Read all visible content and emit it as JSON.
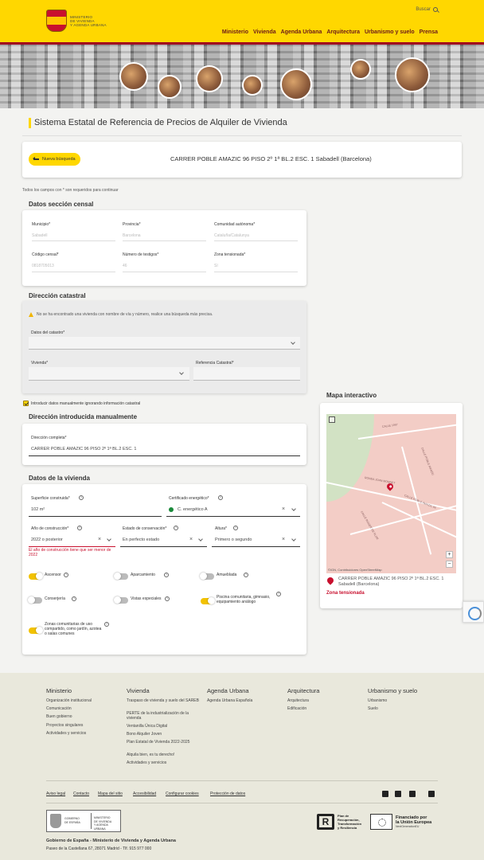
{
  "header": {
    "logo_lines": [
      "MINISTERIO",
      "DE VIVIENDA",
      "Y AGENDA URBANA"
    ],
    "search_label": "Buscar",
    "nav": [
      "Ministerio",
      "Vivienda",
      "Agenda Urbana",
      "Arquitectura",
      "Urbanismo y suelo",
      "Prensa"
    ]
  },
  "page": {
    "title": "Sistema Estatal de Referencia de Precios de Alquiler de Vivienda",
    "back_button": "Nueva búsqueda",
    "address": "CARRER POBLE AMAZIC 96 PISO 2º 1ª BL.2 ESC. 1 Sabadell (Barcelona)",
    "required_note": "Todos los campos con * son requeridos para continuar"
  },
  "censal": {
    "title": "Datos sección censal",
    "fields": [
      {
        "label": "Municipio*",
        "value": "Sabadell"
      },
      {
        "label": "Provincia*",
        "value": "Barcelona"
      },
      {
        "label": "Comunidad autónoma*",
        "value": "Cataluña/Catalunya"
      },
      {
        "label": "Código censal*",
        "value": "0818705013"
      },
      {
        "label": "Número de testigos*",
        "value": "46"
      },
      {
        "label": "Zona tensionada*",
        "value": "Sí"
      }
    ]
  },
  "catastral": {
    "title": "Dirección catastral",
    "warning": "No se ha encontrado una vivienda con nombre de vía y número, realice una búsqueda más precisa.",
    "datos_label": "Datos del catastro*",
    "vivienda_label": "Vivienda*",
    "referencia_label": "Referencia Catastral*",
    "manual_checkbox": "Introducir datos manualmente ignorando información catastral"
  },
  "manual": {
    "title": "Dirección introducida manualmente",
    "label": "Dirección completa*",
    "value": "CARRER POBLE AMAZIC 96 PISO 2º 1ª BL.2 ESC. 1"
  },
  "vivienda": {
    "title": "Datos de la vivienda",
    "superficie_label": "Superficie construida*",
    "superficie_value": "102 m²",
    "certificado_label": "Certificado energético*",
    "certificado_value": "C. energético A",
    "anio_label": "Año de construcción*",
    "anio_value": "2022 o posterior",
    "anio_error": "El año de construcción tiene que ser menor de 2022",
    "estado_label": "Estado de conservación*",
    "estado_value": "En perfecto estado",
    "altura_label": "Altura*",
    "altura_value": "Primero o segundo",
    "toggles": [
      {
        "label": "Ascensor",
        "on": true
      },
      {
        "label": "Aparcamiento",
        "on": false
      },
      {
        "label": "Amueblada",
        "on": false
      },
      {
        "label": "Conserjería",
        "on": false
      },
      {
        "label": "Vistas especiales",
        "on": false
      },
      {
        "label": "Piscina comunitaria, gimnasio, equipamiento análogo",
        "on": true
      },
      {
        "label": "Zonas comunitarias de uso compartido, como jardín, azotea o salas comunes",
        "on": true
      }
    ]
  },
  "map": {
    "title": "Mapa interactivo",
    "streets": [
      "CALLE 1967",
      "CALLE POBLE AMAZIC 96",
      "RONDA JOAN MONNET",
      "CALLE POBLE AMAZIC",
      "CALLE ROGER DE FLOR"
    ],
    "attribution": "©IGN, Contribuidores OpenStreetMap",
    "address_line1": "CARRER POBLE AMAZIC 96 PISO 2º 1ª BL.2 ESC. 1",
    "address_line2": "Sabadell (Barcelona)",
    "zona": "Zona tensionada",
    "zoom_in": "+",
    "zoom_out": "−"
  },
  "footer": {
    "columns": [
      {
        "title": "Ministerio",
        "links": [
          "Organización institucional",
          "Comunicación",
          "Buen gobierno",
          "Proyectos singulares",
          "Actividades y servicios"
        ]
      },
      {
        "title": "Vivienda",
        "links": [
          "Traspaso de vivienda y suelo del SAREB",
          "PERTE de la industrialización de la vivienda",
          "Ventanilla Única Digital",
          "Bono Alquiler Joven",
          "Plan Estatal de Vivienda 2022-2025",
          "Alquila bien, es tu derecho!",
          "Actividades y servicios"
        ]
      },
      {
        "title": "Agenda Urbana",
        "links": [
          "Agenda Urbana Española"
        ]
      },
      {
        "title": "Arquitectura",
        "links": [
          "Arquitectura",
          "Edificación"
        ]
      },
      {
        "title": "Urbanismo y suelo",
        "links": [
          "Urbanismo",
          "Suelo"
        ]
      }
    ],
    "legal": [
      "Aviso legal",
      "Contacto",
      "Mapa del sitio",
      "Accesibilidad",
      "Configurar cookies",
      "Protección de datos"
    ],
    "gob_left": [
      "GOBIERNO",
      "DE ESPAÑA"
    ],
    "gob_right": [
      "MINISTERIO",
      "DE VIVIENDA",
      "Y AGENDA URBANA"
    ],
    "prtr": [
      "Plan de",
      "Recuperación,",
      "Transformación",
      "y Resiliencia"
    ],
    "prtr_mark": "R",
    "eu_line1": "Financiado por",
    "eu_line2": "la Unión Europea",
    "eu_sub": "NextGenerationEU",
    "title": "Gobierno de España - Ministerio de Vivienda y Agenda Urbana",
    "address": "Paseo de la Castellana 67, 28071 Madrid - Tlf. 915 977 000"
  },
  "colors": {
    "accent": "#ffd700",
    "brand": "#a0001e",
    "error": "#c8102e"
  }
}
